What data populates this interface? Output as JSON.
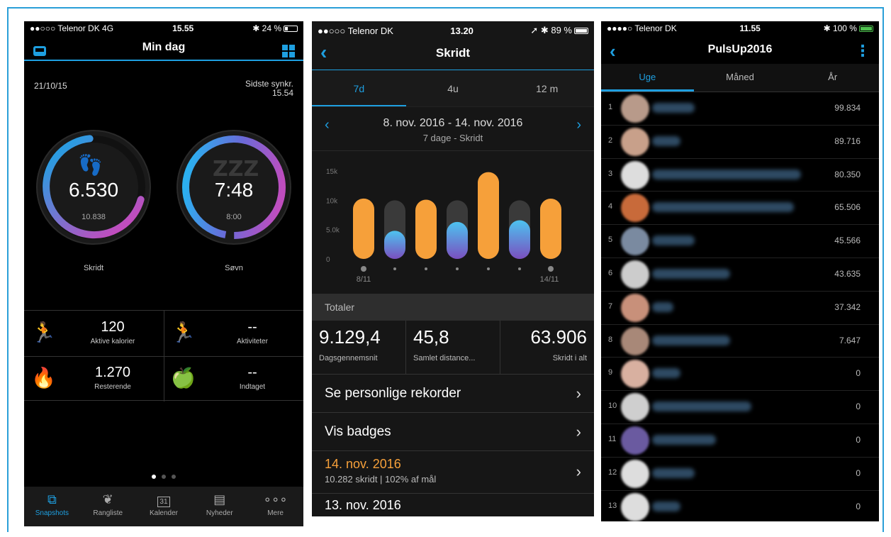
{
  "colors": {
    "accent": "#1e9fe0",
    "orange": "#f6a03a",
    "purple": "#7a4fbf",
    "cyan": "#4dc3f0"
  },
  "panel1": {
    "status": {
      "carrier": "●●○○○ Telenor DK  4G",
      "time": "15.55",
      "battery": "24 %"
    },
    "title": "Min dag",
    "date": "21/10/15",
    "sync_label": "Sidste synkr.",
    "sync_time": "15.54",
    "steps_ring": {
      "value": "6.530",
      "goal": "10.838",
      "label": "Skridt",
      "progress": 0.6
    },
    "sleep_ring": {
      "value": "7:48",
      "goal": "8:00",
      "label": "Søvn",
      "progress": 0.97
    },
    "stats": [
      {
        "icon": "running-icon",
        "value": "120",
        "label": "Aktive kalorier"
      },
      {
        "icon": "runner-icon",
        "value": "--",
        "label": "Aktiviteter"
      },
      {
        "icon": "flame-icon",
        "value": "1.270",
        "label": "Resterende"
      },
      {
        "icon": "apple-icon",
        "value": "--",
        "label": "Indtaget"
      }
    ],
    "tabs": [
      {
        "label": "Snapshots",
        "icon": "snapshots-icon"
      },
      {
        "label": "Rangliste",
        "icon": "laurel-icon"
      },
      {
        "label": "Kalender",
        "icon": "calendar-icon",
        "glyph": "31"
      },
      {
        "label": "Nyheder",
        "icon": "newspaper-icon"
      },
      {
        "label": "Mere",
        "icon": "more-icon"
      }
    ]
  },
  "panel2": {
    "status": {
      "carrier": "●●○○○ Telenor DK",
      "time": "13.20",
      "battery": "89 %"
    },
    "title": "Skridt",
    "segments": [
      "7d",
      "4u",
      "12 m"
    ],
    "range_title": "8. nov. 2016 - 14. nov. 2016",
    "range_sub": "7 dage - Skridt",
    "chart_data": {
      "type": "bar",
      "categories": [
        "8/11",
        "",
        "",
        "",
        "",
        "",
        "14/11"
      ],
      "yticks": [
        "15k",
        "10k",
        "5.0k",
        "0"
      ],
      "ylim": [
        0,
        15000
      ],
      "goal": [
        10000,
        10000,
        10000,
        10000,
        10000,
        10000,
        10000
      ],
      "series": [
        {
          "values": [
            10300,
            4800,
            10100,
            6300,
            14800,
            6600,
            10282
          ]
        }
      ],
      "orange_when_goal_met": true
    },
    "totals_label": "Totaler",
    "totals": [
      {
        "value": "9.129,4",
        "label": "Dagsgennemsnit"
      },
      {
        "value": "45,8",
        "label": "Samlet distance..."
      },
      {
        "value": "63.906",
        "label": "Skridt i alt"
      }
    ],
    "rows": [
      "Se personlige rekorder",
      "Vis badges"
    ],
    "day": {
      "date": "14. nov. 2016",
      "summary": "10.282 skridt | 102% af mål"
    },
    "day2": "13. nov. 2016"
  },
  "panel3": {
    "status": {
      "carrier": "●●●●○ Telenor DK",
      "time": "11.55",
      "battery": "100 %"
    },
    "title": "PulsUp2016",
    "segments": [
      "Uge",
      "Måned",
      "År"
    ],
    "leaders": [
      {
        "rank": "1",
        "score": "99.834"
      },
      {
        "rank": "2",
        "score": "89.716"
      },
      {
        "rank": "3",
        "score": "80.350"
      },
      {
        "rank": "4",
        "score": "65.506"
      },
      {
        "rank": "5",
        "score": "45.566"
      },
      {
        "rank": "6",
        "score": "43.635"
      },
      {
        "rank": "7",
        "score": "37.342"
      },
      {
        "rank": "8",
        "score": "7.647"
      },
      {
        "rank": "9",
        "score": "0"
      },
      {
        "rank": "10",
        "score": "0"
      },
      {
        "rank": "11",
        "score": "0"
      },
      {
        "rank": "12",
        "score": "0"
      },
      {
        "rank": "13",
        "score": "0"
      }
    ]
  }
}
